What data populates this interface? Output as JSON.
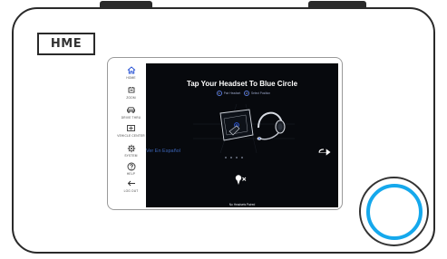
{
  "device": {
    "brand": "HME"
  },
  "sidebar": {
    "items": [
      {
        "label": "HOME",
        "icon": "home-icon",
        "active": true
      },
      {
        "label": "ZOOM",
        "icon": "zoom-icon",
        "active": false
      },
      {
        "label": "DRIVE THRU",
        "icon": "car-icon",
        "active": false
      },
      {
        "label": "VEHICLE CENTER",
        "icon": "vehicle-center-icon",
        "active": false
      },
      {
        "label": "SYSTEM",
        "icon": "gear-icon",
        "active": false
      },
      {
        "label": "HELP",
        "icon": "help-icon",
        "active": false
      },
      {
        "label": "LOG OUT",
        "icon": "logout-icon",
        "active": false
      }
    ]
  },
  "main": {
    "title": "Tap Your Headset To Blue Circle",
    "steps": [
      {
        "number": "1",
        "label": "Pair Headset"
      },
      {
        "number": "2",
        "label": "Select Position"
      }
    ],
    "language_link": "Ver En Español",
    "status": "No Headsets Paired"
  },
  "colors": {
    "accent": "#2d57d6",
    "ring": "#15a8ec",
    "panel_bg": "#07090d",
    "spanish_link": "#3c65b8"
  }
}
